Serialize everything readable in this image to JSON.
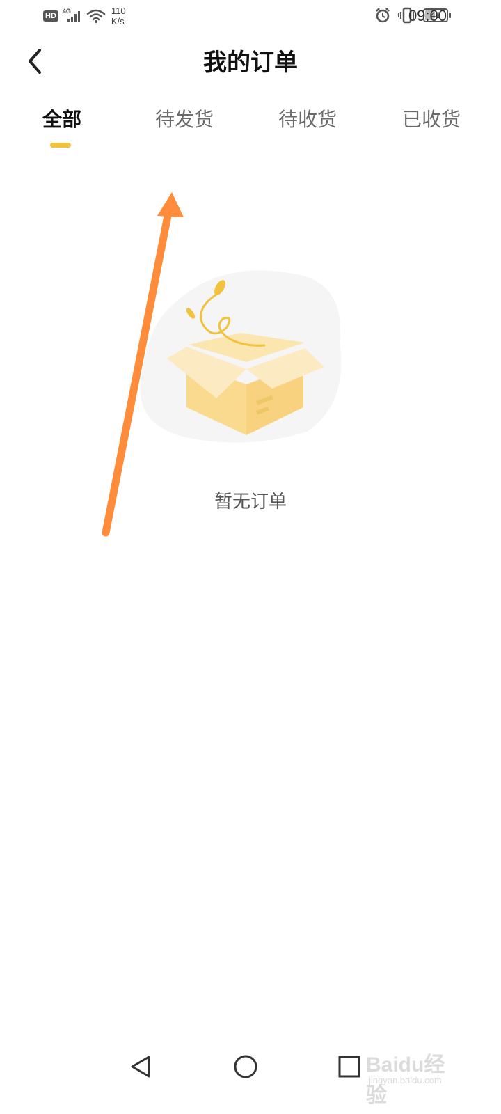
{
  "status_bar": {
    "hd": "HD",
    "network": "4G",
    "speed_value": "110",
    "speed_unit": "K/s",
    "battery": "41",
    "time": "09:00"
  },
  "header": {
    "title": "我的订单",
    "back_icon": "chevron-left-icon"
  },
  "tabs": [
    {
      "label": "全部",
      "active": true
    },
    {
      "label": "待发货",
      "active": false
    },
    {
      "label": "待收货",
      "active": false
    },
    {
      "label": "已收货",
      "active": false
    }
  ],
  "empty_state": {
    "illustration": "open-box-icon",
    "message": "暂无订单"
  },
  "nav_bar": {
    "back": "triangle-back-icon",
    "home": "circle-home-icon",
    "recents": "square-recents-icon"
  },
  "watermark": {
    "logo_text": "Baidu经验",
    "url": "jingyan.baidu.com"
  },
  "colors": {
    "accent": "#F2C23C",
    "annotation_arrow": "#FF8C3A",
    "box_light": "#FBE6B0",
    "box_mid": "#F9DA8E",
    "blob": "#F5F5F5"
  }
}
